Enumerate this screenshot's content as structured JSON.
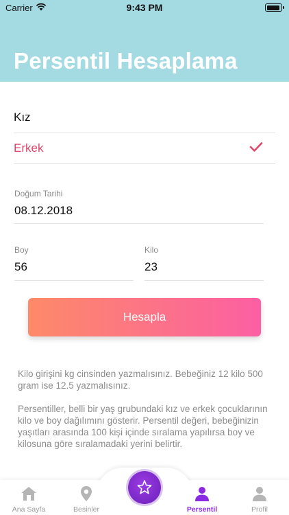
{
  "status": {
    "carrier": "Carrier",
    "time": "9:43 PM"
  },
  "header": {
    "title": "Persentil Hesaplama"
  },
  "gender": {
    "options": [
      {
        "label": "Kız",
        "selected": false
      },
      {
        "label": "Erkek",
        "selected": true
      }
    ]
  },
  "birth": {
    "label": "Doğum Tarihi",
    "value": "08.12.2018"
  },
  "height": {
    "label": "Boy",
    "value": "56"
  },
  "weight": {
    "label": "Kilo",
    "value": "23"
  },
  "calculate_label": "Hesapla",
  "info": {
    "p1": "Kilo girişini kg cinsinden yazmalısınız. Bebeğiniz 12 kilo 500 gram ise 12.5 yazmalısınız.",
    "p2": "Persentiller, belli bir yaş grubundaki kız ve erkek çocuklarının kilo ve boy dağılımını gösterir. Persentil değeri, bebeğinizin yaşıtları arasında 100 kişi içinde sıralama yapılırsa boy ve kilosuna göre sıralamadaki yerini belirtir."
  },
  "tabs": [
    {
      "label": "Ana Sayfa",
      "icon": "home-icon",
      "active": false
    },
    {
      "label": "Besinler",
      "icon": "location-pin-icon",
      "active": false
    },
    {
      "label": "",
      "icon": "star-icon",
      "active": false
    },
    {
      "label": "Persentil",
      "icon": "person-icon",
      "active": true
    },
    {
      "label": "Profil",
      "icon": "profile-icon",
      "active": false
    }
  ],
  "colors": {
    "header_bg": "#a4dbe3",
    "selected_accent": "#e0466b",
    "button_gradient_start": "#fd8a68",
    "button_gradient_end": "#fc5fa3",
    "active_tab": "#8a2be2"
  }
}
